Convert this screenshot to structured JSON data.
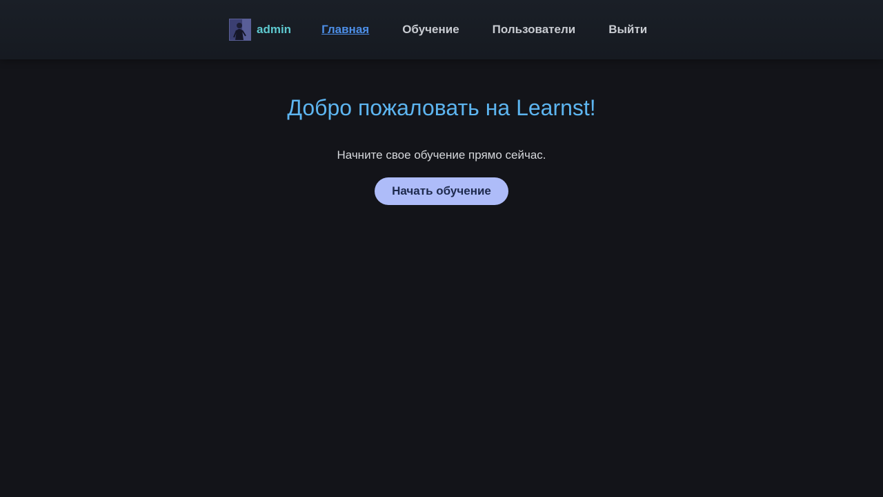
{
  "header": {
    "username": "admin",
    "nav": {
      "home": "Главная",
      "learning": "Обучение",
      "users": "Пользователи",
      "logout": "Выйти"
    },
    "active_item": "home"
  },
  "main": {
    "title": "Добро пожаловать на Learnst!",
    "subtitle": "Начните свое обучение прямо сейчас.",
    "start_button": "Начать обучение"
  },
  "colors": {
    "background": "#131419",
    "username": "#5ec9cf",
    "active_link": "#4d8fe8",
    "title": "#5db5f0",
    "button_bg": "#aebcf9"
  }
}
